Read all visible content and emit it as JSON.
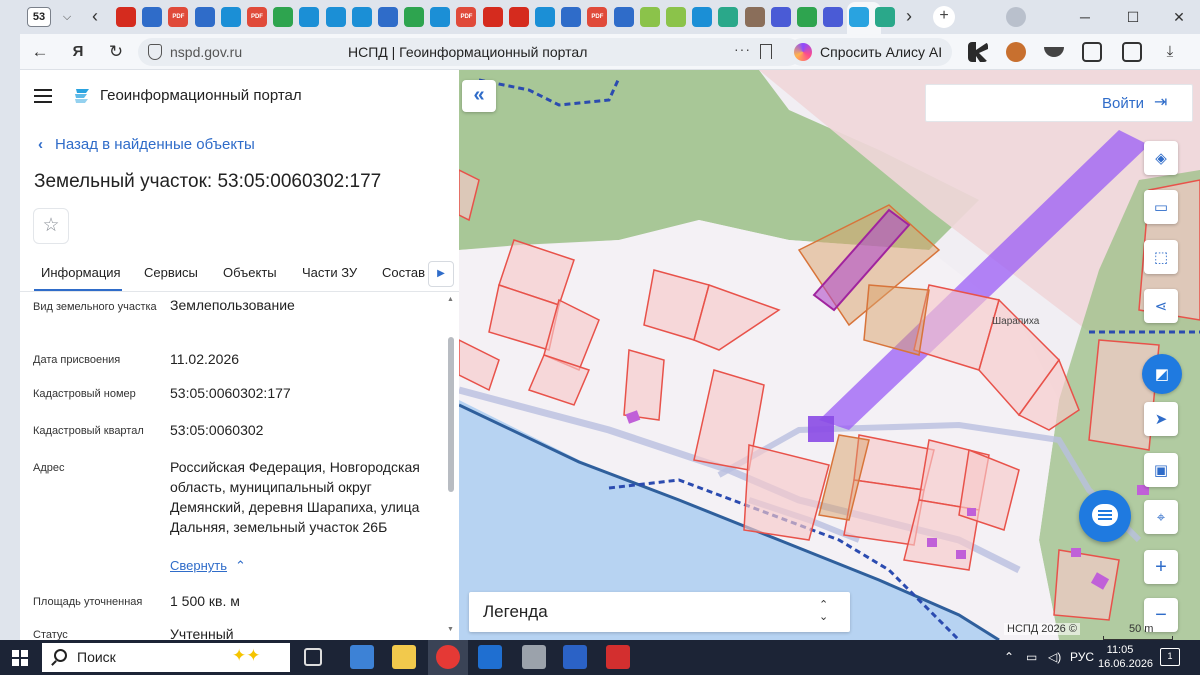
{
  "browser": {
    "tab_count": "53",
    "url": "nspd.gov.ru",
    "page_title": "НСПД | Геоинформационный портал",
    "alice_label": "Спросить Алису AI",
    "tab_icons": [
      {
        "name": "ru-flag-tab",
        "color": "#d52b1e",
        "label": ""
      },
      {
        "name": "blue-doc-tab",
        "color": "#2f6cc9",
        "label": ""
      },
      {
        "name": "pdf-tab",
        "color": "#e04a3a",
        "label": "PDF"
      },
      {
        "name": "blue-doc-tab",
        "color": "#2f6cc9",
        "label": ""
      },
      {
        "name": "blue-doc-tab",
        "color": "#1b8fd6",
        "label": ""
      },
      {
        "name": "pdf-tab",
        "color": "#e04a3a",
        "label": "PDF"
      },
      {
        "name": "green-doc-tab",
        "color": "#2ea44f",
        "label": ""
      },
      {
        "name": "mail-tab",
        "color": "#1b8fd6",
        "label": ""
      },
      {
        "name": "blue-doc-tab",
        "color": "#1b8fd6",
        "label": ""
      },
      {
        "name": "mail-tab",
        "color": "#1b8fd6",
        "label": ""
      },
      {
        "name": "blue-doc-tab",
        "color": "#2f6cc9",
        "label": ""
      },
      {
        "name": "green-doc-tab",
        "color": "#2ea44f",
        "label": ""
      },
      {
        "name": "mail-tab",
        "color": "#1b8fd6",
        "label": ""
      },
      {
        "name": "pdf-tab",
        "color": "#e04a3a",
        "label": "PDF"
      },
      {
        "name": "ru-flag-tab",
        "color": "#d52b1e",
        "label": ""
      },
      {
        "name": "ru-flag-tab",
        "color": "#d52b1e",
        "label": ""
      },
      {
        "name": "mail-tab",
        "color": "#1b8fd6",
        "label": ""
      },
      {
        "name": "blue-doc-tab",
        "color": "#2f6cc9",
        "label": ""
      },
      {
        "name": "pdf-tab",
        "color": "#e04a3a",
        "label": "PDF"
      },
      {
        "name": "blue-doc-tab",
        "color": "#2f6cc9",
        "label": ""
      },
      {
        "name": "check-tab",
        "color": "#8bc34a",
        "label": ""
      },
      {
        "name": "check-tab",
        "color": "#8bc34a",
        "label": ""
      },
      {
        "name": "blue-doc-tab",
        "color": "#1b8fd6",
        "label": ""
      },
      {
        "name": "cross-tab",
        "color": "#2aa88a",
        "label": ""
      },
      {
        "name": "avatar-tab",
        "color": "#8a6e5a",
        "label": ""
      },
      {
        "name": "chat-tab",
        "color": "#4a5bd6",
        "label": ""
      },
      {
        "name": "green-doc-tab",
        "color": "#2ea44f",
        "label": ""
      },
      {
        "name": "chat-tab",
        "color": "#4a5bd6",
        "label": ""
      },
      {
        "name": "nspd-tab",
        "color": "#29a3e0",
        "label": ""
      },
      {
        "name": "cross-tab",
        "color": "#2aa88a",
        "label": ""
      }
    ]
  },
  "panel": {
    "portal_name": "Геоинформационный портал",
    "back_label": "Назад в найденные объекты",
    "object_title": "Земельный участок: 53:05:0060302:177",
    "tabs": [
      {
        "label": "Информация"
      },
      {
        "label": "Сервисы"
      },
      {
        "label": "Объекты"
      },
      {
        "label": "Части ЗУ"
      },
      {
        "label": "Состав"
      }
    ],
    "attributes": [
      {
        "label": "Вид земельного участка",
        "value": "Землепользование"
      },
      {
        "label": "Дата присвоения",
        "value": "11.02.2026"
      },
      {
        "label": "Кадастровый номер",
        "value": "53:05:0060302:177"
      },
      {
        "label": "Кадастровый квартал",
        "value": "53:05:0060302"
      },
      {
        "label": "Адрес",
        "value": "Российская Федерация, Новгородская область, муниципальный округ Демянский, деревня Шарапиха, улица Дальняя, земельный участок 26Б"
      },
      {
        "label": "Площадь уточненная",
        "value": "1 500 кв. м"
      },
      {
        "label": "Статус",
        "value": "Учтенный"
      }
    ],
    "collapse_label": "Свернуть"
  },
  "map": {
    "login_label": "Войти",
    "place_name": "Шарапиха",
    "legend_label": "Легенда",
    "copyright": "НСПД 2026 ©",
    "scale_label": "50 m",
    "colors": {
      "forest": "#9bbf86",
      "residential": "#f0d6d9",
      "water": "#b7d3f2",
      "parcel_stroke": "#e8524a",
      "highlight": "#9b5cf5",
      "accent": "#2f6cc9"
    }
  },
  "taskbar": {
    "search_label": "Поиск",
    "language": "РУС",
    "time": "11:05",
    "date": "16.06.2026",
    "notifications": "1"
  }
}
